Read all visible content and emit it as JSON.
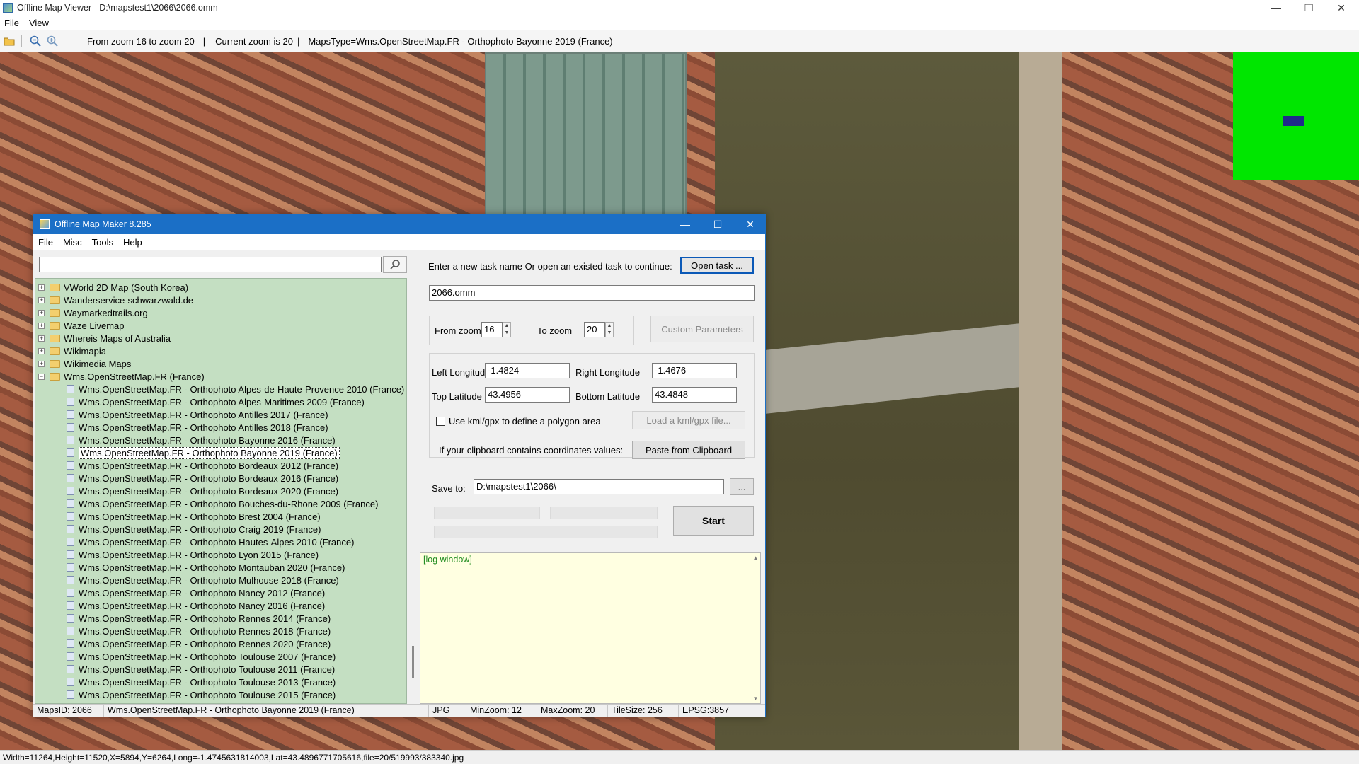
{
  "window": {
    "title": "Offline Map Viewer - D:\\mapstest1\\2066\\2066.omm",
    "controls": {
      "minimize": "—",
      "maximize": "❐",
      "close": "✕"
    }
  },
  "menu": [
    "File",
    "View"
  ],
  "toolbar": {
    "zoom_range": "From zoom 16 to zoom 20",
    "current_zoom": "Current zoom is 20",
    "maps_type": "MapsType=Wms.OpenStreetMap.FR - Orthophoto Bayonne 2019 (France)",
    "icons": [
      "folder-open-icon",
      "zoom-out-icon",
      "zoom-in-icon"
    ]
  },
  "statusbar": {
    "text": "Width=11264,Height=11520,X=5894,Y=6264,Long=-1.4745631814003,Lat=43.4896771705616,file=20/519993/383340.jpg"
  },
  "dialog": {
    "title": "Offline Map Maker 8.285",
    "controls": {
      "minimize": "—",
      "maximize": "☐",
      "close": "✕"
    },
    "menu": [
      "File",
      "Misc",
      "Tools",
      "Help"
    ],
    "search_icon": "search-icon",
    "tree": {
      "groups": [
        {
          "label": "VWorld 2D Map (South Korea)",
          "expanded": false
        },
        {
          "label": "Wanderservice-schwarzwald.de",
          "expanded": false
        },
        {
          "label": "Waymarkedtrails.org",
          "expanded": false
        },
        {
          "label": "Waze Livemap",
          "expanded": false
        },
        {
          "label": "Whereis Maps of Australia",
          "expanded": false
        },
        {
          "label": "Wikimapia",
          "expanded": false
        },
        {
          "label": "Wikimedia Maps",
          "expanded": false
        },
        {
          "label": "Wms.OpenStreetMap.FR (France)",
          "expanded": true
        }
      ],
      "items": [
        "Wms.OpenStreetMap.FR - Orthophoto Alpes-de-Haute-Provence 2010 (France)",
        "Wms.OpenStreetMap.FR - Orthophoto Alpes-Maritimes 2009 (France)",
        "Wms.OpenStreetMap.FR - Orthophoto Antilles 2017 (France)",
        "Wms.OpenStreetMap.FR - Orthophoto Antilles 2018 (France)",
        "Wms.OpenStreetMap.FR - Orthophoto Bayonne 2016 (France)",
        "Wms.OpenStreetMap.FR - Orthophoto Bayonne 2019 (France)",
        "Wms.OpenStreetMap.FR - Orthophoto Bordeaux 2012 (France)",
        "Wms.OpenStreetMap.FR - Orthophoto Bordeaux 2016 (France)",
        "Wms.OpenStreetMap.FR - Orthophoto Bordeaux 2020 (France)",
        "Wms.OpenStreetMap.FR - Orthophoto Bouches-du-Rhone 2009 (France)",
        "Wms.OpenStreetMap.FR - Orthophoto Brest 2004 (France)",
        "Wms.OpenStreetMap.FR - Orthophoto Craig 2019 (France)",
        "Wms.OpenStreetMap.FR - Orthophoto Hautes-Alpes 2010 (France)",
        "Wms.OpenStreetMap.FR - Orthophoto Lyon 2015 (France)",
        "Wms.OpenStreetMap.FR - Orthophoto Montauban 2020 (France)",
        "Wms.OpenStreetMap.FR - Orthophoto Mulhouse 2018 (France)",
        "Wms.OpenStreetMap.FR - Orthophoto Nancy 2012 (France)",
        "Wms.OpenStreetMap.FR - Orthophoto Nancy 2016 (France)",
        "Wms.OpenStreetMap.FR - Orthophoto Rennes 2014 (France)",
        "Wms.OpenStreetMap.FR - Orthophoto Rennes 2018 (France)",
        "Wms.OpenStreetMap.FR - Orthophoto Rennes 2020 (France)",
        "Wms.OpenStreetMap.FR - Orthophoto Toulouse 2007 (France)",
        "Wms.OpenStreetMap.FR - Orthophoto Toulouse 2011 (France)",
        "Wms.OpenStreetMap.FR - Orthophoto Toulouse 2013 (France)",
        "Wms.OpenStreetMap.FR - Orthophoto Toulouse 2015 (France)"
      ],
      "selected": "Wms.OpenStreetMap.FR - Orthophoto Bayonne 2019 (France)"
    },
    "task": {
      "prompt": "Enter a new task name Or open an existed task to continue:",
      "open_label": "Open task ...",
      "name": "2066.omm"
    },
    "zoom": {
      "from_label": "From zoom",
      "from_value": "16",
      "to_label": "To zoom",
      "to_value": "20",
      "custom_label": "Custom Parameters"
    },
    "bounds": {
      "left_label": "Left Longitude",
      "left_value": "-1.4824",
      "right_label": "Right Longitude",
      "right_value": "-1.4676",
      "top_label": "Top Latitude",
      "top_value": "43.4956",
      "bottom_label": "Bottom Latitude",
      "bottom_value": "43.4848"
    },
    "kml": {
      "label": "Use kml/gpx to define a polygon area",
      "checked": false,
      "load_label": "Load a kml/gpx file..."
    },
    "clipboard": {
      "label": "If your clipboard contains coordinates values:",
      "button": "Paste from Clipboard"
    },
    "save": {
      "label": "Save to:",
      "path": "D:\\mapstest1\\2066\\",
      "browse": "..."
    },
    "start_label": "Start",
    "log": {
      "text": "[log window]"
    },
    "status": {
      "maps_id": "MapsID: 2066",
      "map_name": "Wms.OpenStreetMap.FR - Orthophoto Bayonne 2019 (France)",
      "format": "JPG",
      "min_zoom": "MinZoom: 12",
      "max_zoom": "MaxZoom: 20",
      "tile_size": "TileSize: 256",
      "epsg": "EPSG:3857"
    }
  }
}
